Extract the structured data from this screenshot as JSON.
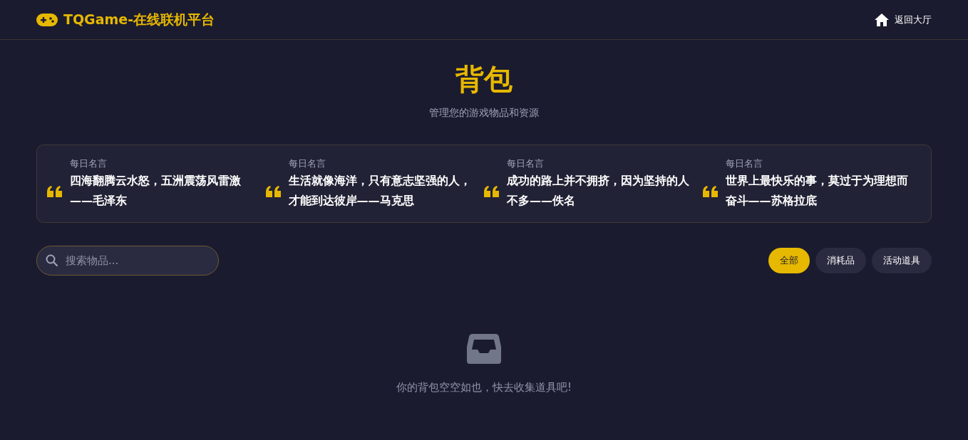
{
  "header": {
    "logo": "TQGame-在线联机平台",
    "back_link": "返回大厅"
  },
  "page": {
    "title": "背包",
    "subtitle": "管理您的游戏物品和资源"
  },
  "quotes": [
    {
      "label": "每日名言",
      "text": "四海翻腾云水怒，五洲震荡风雷激——毛泽东"
    },
    {
      "label": "每日名言",
      "text": "生活就像海洋，只有意志坚强的人，才能到达彼岸——马克思"
    },
    {
      "label": "每日名言",
      "text": "成功的路上并不拥挤，因为坚持的人不多——佚名"
    },
    {
      "label": "每日名言",
      "text": "世界上最快乐的事，莫过于为理想而奋斗——苏格拉底"
    }
  ],
  "search": {
    "placeholder": "搜索物品..."
  },
  "filters": [
    {
      "label": "全部",
      "selected": true
    },
    {
      "label": "消耗品",
      "selected": false
    },
    {
      "label": "活动道具",
      "selected": false
    }
  ],
  "empty_state": {
    "message": "你的背包空空如也，快去收集道具吧!"
  }
}
